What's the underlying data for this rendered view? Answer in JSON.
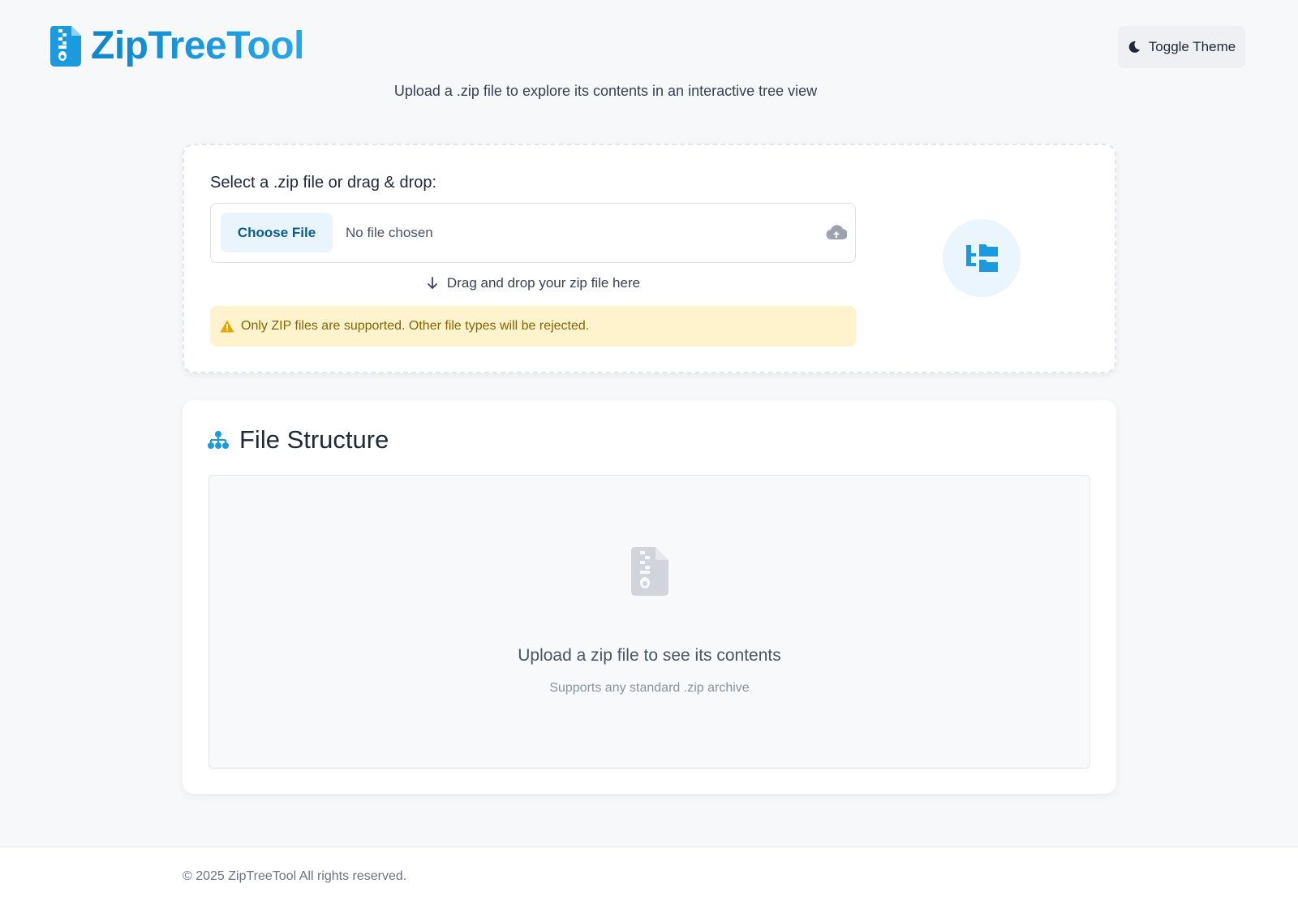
{
  "header": {
    "brand": "ZipTreeTool",
    "toggle_theme_label": "Toggle Theme",
    "tagline": "Upload a .zip file to explore its contents in an interactive tree view"
  },
  "upload": {
    "label": "Select a .zip file or drag & drop:",
    "choose_file_label": "Choose File",
    "no_file_text": "No file chosen",
    "drag_hint": "Drag and drop your zip file here",
    "warning": "Only ZIP files are supported. Other file types will be rejected."
  },
  "structure": {
    "title": "File Structure",
    "empty_main": "Upload a zip file to see its contents",
    "empty_sub": "Supports any standard .zip archive"
  },
  "footer": {
    "copyright": "© 2025 ZipTreeTool All rights reserved."
  },
  "icons": {
    "logo": "file-zipper-icon",
    "theme": "moon-icon",
    "upload": "cloud-upload-icon",
    "drag": "arrow-down-icon",
    "warning": "warning-triangle-icon",
    "tree": "folder-tree-icon",
    "structure": "sitemap-icon",
    "empty": "file-zipper-icon"
  },
  "colors": {
    "brand": "#1a9be0",
    "background": "#f6f8fa",
    "warning_bg": "#fff3cd",
    "warning_text": "#856404",
    "button_bg": "#eaf4fd",
    "button_text": "#0b5c8f"
  }
}
